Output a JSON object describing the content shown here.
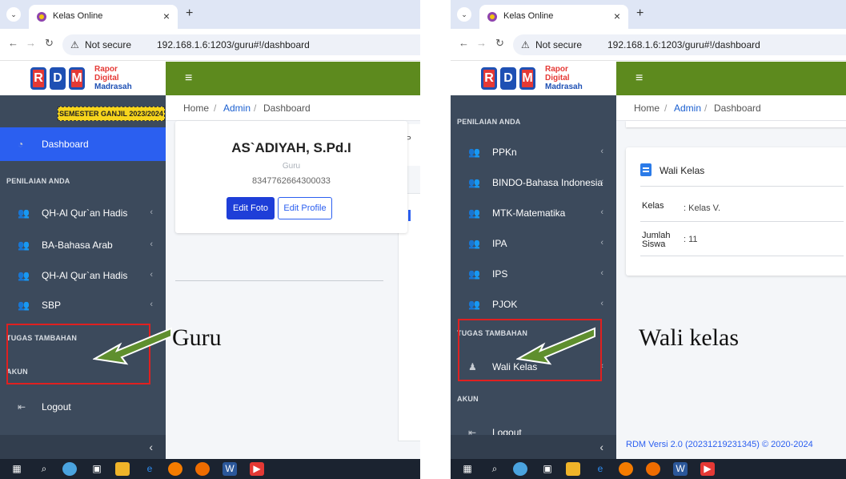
{
  "left": {
    "browser": {
      "tab_title": "Kelas Online",
      "tab_close": "×",
      "new_tab": "+",
      "security": "Not secure",
      "url": "192.168.1.6:1203/guru#!/dashboard"
    },
    "logo": {
      "mark": "RDM",
      "line1": "Rapor",
      "line2": "Digital",
      "line3": "Madrasah"
    },
    "semester": "SEMESTER GANJIL 2023/2024",
    "breadcrumb": {
      "home": "Home",
      "sep1": "/",
      "admin": "Admin",
      "sep2": "/",
      "current": "Dashboard"
    },
    "menu": {
      "dashboard": "Dashboard",
      "section_penilaian": "PENILAIAN ANDA",
      "items": [
        "QH-Al Qur`an Hadis",
        "BA-Bahasa Arab",
        "QH-Al Qur`an Hadis",
        "SBP"
      ],
      "section_tugas": "TUGAS TAMBAHAN",
      "section_akun": "AKUN",
      "logout": "Logout"
    },
    "profile": {
      "name": "AS`ADIYAH, S.Pd.I",
      "role": "Guru",
      "nip": "8347762664300033",
      "edit_foto": "Edit Foto",
      "edit_profile": "Edit Profile"
    },
    "side_card_letter": "P",
    "annotation": "Guru"
  },
  "right": {
    "browser": {
      "tab_title": "Kelas Online",
      "tab_close": "×",
      "new_tab": "+",
      "security": "Not secure",
      "url": "192.168.1.6:1203/guru#!/dashboard"
    },
    "logo": {
      "mark": "RDM",
      "line1": "Rapor",
      "line2": "Digital",
      "line3": "Madrasah"
    },
    "breadcrumb": {
      "home": "Home",
      "sep1": "/",
      "admin": "Admin",
      "sep2": "/",
      "current": "Dashboard"
    },
    "menu": {
      "section_penilaian": "PENILAIAN ANDA",
      "items": [
        "PPKn",
        "BINDO-Bahasa Indonesia",
        "MTK-Matematika",
        "IPA",
        "IPS",
        "PJOK"
      ],
      "section_tugas": "TUGAS TAMBAHAN",
      "wali_kelas": "Wali Kelas",
      "section_akun": "AKUN",
      "logout": "Logout"
    },
    "wali_card": {
      "title": "Wali Kelas",
      "kelas_label": "Kelas",
      "kelas_value": ": Kelas V.",
      "jumlah_label_1": "Jumlah",
      "jumlah_label_2": "Siswa",
      "jumlah_value": ": 11"
    },
    "footer": "RDM Versi 2.0 (20231219231345) © 2020-2024",
    "annotation": "Wali kelas"
  },
  "colors": {
    "topbar": "#5d8a1e",
    "sidebar": "#3c4a5c",
    "active": "#2b5ff0",
    "semester_badge": "#f7d51c",
    "annotation_box": "#e02020",
    "arrow": "#5f8f2e"
  },
  "icons": [
    "chevron-down-icon",
    "back-icon",
    "forward-icon",
    "reload-icon",
    "warning-icon",
    "hamburger-icon",
    "dashboard-icon",
    "users-icon",
    "user-icon",
    "logout-icon",
    "chevron-left-icon",
    "clipboard-icon",
    "windows-icon",
    "search-icon",
    "edge-icon",
    "firefox-icon",
    "chrome-icon",
    "word-icon",
    "youtube-icon"
  ]
}
